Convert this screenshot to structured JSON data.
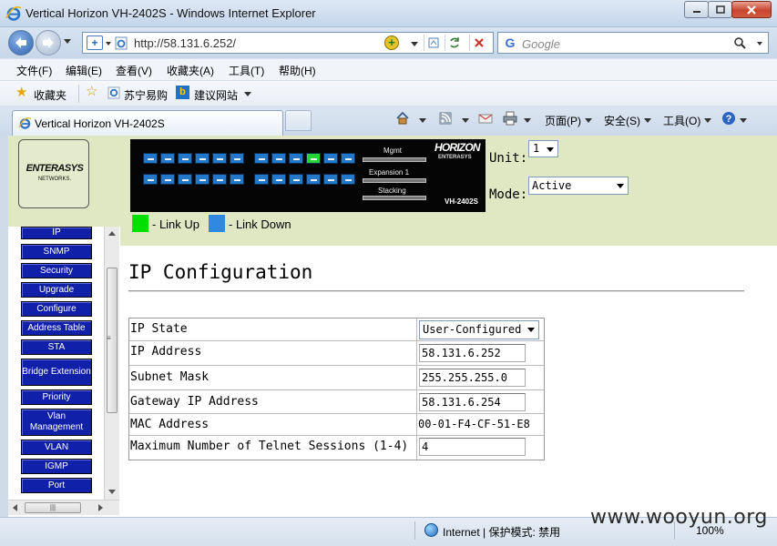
{
  "window": {
    "title": "Vertical Horizon VH-2402S - Windows Internet Explorer"
  },
  "address_bar": {
    "url": "http://58.131.6.252/",
    "search_placeholder": "Google"
  },
  "menu": {
    "items": [
      "文件(F)",
      "编辑(E)",
      "查看(V)",
      "收藏夹(A)",
      "工具(T)",
      "帮助(H)"
    ]
  },
  "favorites_bar": {
    "label": "收藏夹",
    "links": [
      "苏宁易购",
      "建议网站"
    ]
  },
  "tab": {
    "label": "Vertical Horizon VH-2402S"
  },
  "command_bar": {
    "page": "页面(P)",
    "safety": "安全(S)",
    "tools": "工具(O)"
  },
  "device": {
    "brand_logo": "ENTERASYS",
    "brand_logo_sub": "NETWORKS.",
    "panel_labels": {
      "mgmt": "Mgmt",
      "expansion": "Expansion 1",
      "stacking": "Stacking",
      "brand": "HORIZON",
      "brand_sub": "ENTERASYS",
      "model": "VH-2402S"
    },
    "legend": {
      "up": "- Link Up",
      "down": "- Link Down"
    },
    "unit_label": "Unit:",
    "unit_value": "1",
    "mode_label": "Mode:",
    "mode_value": "Active",
    "colors": {
      "link_up": "#00e000",
      "link_down": "#2f89e0",
      "nav_button": "#1020a8",
      "header_bg": "#dfe8c3"
    }
  },
  "nav": {
    "items": [
      "IP",
      "SNMP",
      "Security",
      "Upgrade",
      "Configure",
      "Address Table",
      "STA",
      "Bridge Extension",
      "Priority",
      "Vlan Management",
      "VLAN",
      "IGMP",
      "Port"
    ]
  },
  "main": {
    "title": "IP Configuration",
    "rows": {
      "ip_state": {
        "label": "IP State",
        "value": "User-Configured"
      },
      "ip_address": {
        "label": "IP Address",
        "value": "58.131.6.252"
      },
      "subnet_mask": {
        "label": "Subnet Mask",
        "value": "255.255.255.0"
      },
      "gateway": {
        "label": "Gateway IP Address",
        "value": "58.131.6.254"
      },
      "mac": {
        "label": "MAC Address",
        "value": "00-01-F4-CF-51-E8"
      },
      "telnet": {
        "label": "Maximum Number of Telnet Sessions (1-4)",
        "value": "4"
      }
    }
  },
  "status_bar": {
    "zone": "Internet | 保护模式: 禁用",
    "zoom": "100%"
  },
  "watermark": "www.wooyun.org"
}
